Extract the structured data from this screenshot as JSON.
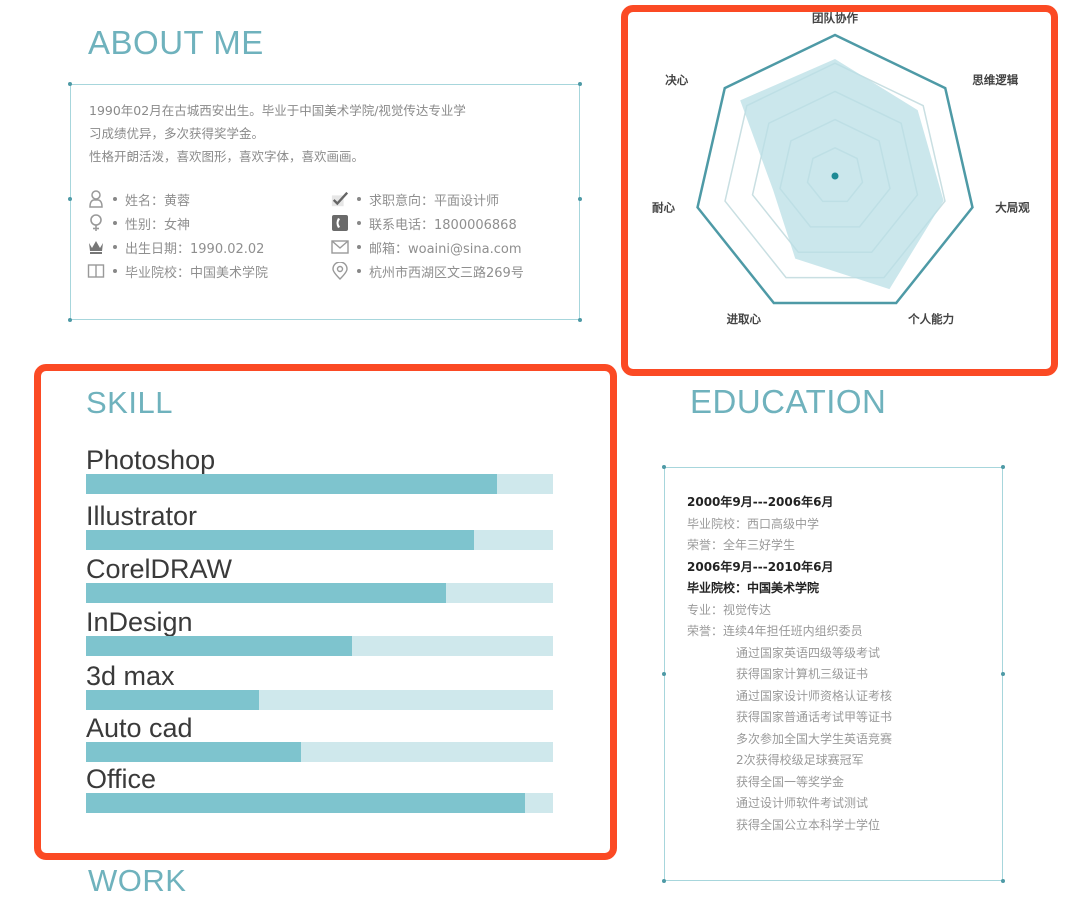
{
  "about": {
    "title": "ABOUT ME",
    "intro": [
      "1990年02月在古城西安出生。毕业于中国美术学院/视觉传达专业学",
      "习成绩优异，多次获得奖学金。",
      "性格开朗活泼，喜欢图形，喜欢字体，喜欢画画。"
    ],
    "left_items": [
      {
        "icon": "person-icon",
        "glyph": "8",
        "text": "姓名：黄蓉"
      },
      {
        "icon": "female-icon",
        "glyph": "♀",
        "text": "性别：女神"
      },
      {
        "icon": "crown-icon",
        "glyph": "♛",
        "text": "出生日期：1990.02.02"
      },
      {
        "icon": "book-icon",
        "glyph": "🕮",
        "text": "毕业院校：中国美术学院"
      }
    ],
    "right_items": [
      {
        "icon": "checkmark-icon",
        "glyph": "✔",
        "text": "求职意向：平面设计师"
      },
      {
        "icon": "phone-icon",
        "glyph": "☎",
        "text": "联系电话：1800006868"
      },
      {
        "icon": "envelope-icon",
        "glyph": "✉",
        "text": "邮箱：woaini@sina.com"
      },
      {
        "icon": "location-pin-icon",
        "glyph": "◎",
        "text": "杭州市西湖区文三路269号"
      }
    ]
  },
  "colors": {
    "accent": "#6fb2bd",
    "bar_fill": "#7ec4ce",
    "bar_track": "#cfe8ec",
    "radar_line": "#4e9aa6",
    "radar_fill": "#b9dfe5",
    "highlight": "#fb4a24"
  },
  "chart_data": [
    {
      "type": "radar",
      "title": "",
      "categories": [
        "团队协作",
        "思维逻辑",
        "大局观",
        "个人能力",
        "进取心",
        "耐心",
        "决心"
      ],
      "values": [
        4.15,
        3.75,
        3.95,
        4.45,
        3.25,
        2.25,
        4.3
      ],
      "range": [
        0,
        5
      ],
      "rings": 5
    },
    {
      "type": "bar",
      "orientation": "horizontal",
      "title": "SKILL",
      "categories": [
        "Photoshop",
        "Illustrator",
        "CorelDRAW",
        "InDesign",
        "3d max",
        "Auto cad",
        "Office"
      ],
      "values": [
        88,
        83,
        77,
        57,
        37,
        46,
        94
      ],
      "range": [
        0,
        100
      ],
      "unit": "percent"
    }
  ],
  "skill": {
    "title": "SKILL"
  },
  "education": {
    "title": "EDUCATION",
    "lines": [
      {
        "text": "2000年9月---2006年6月",
        "style": "strong"
      },
      {
        "text": "毕业院校：西口高级中学",
        "style": "normal"
      },
      {
        "text": "荣誉：全年三好学生",
        "style": "normal"
      },
      {
        "text": "2006年9月---2010年6月",
        "style": "strong"
      },
      {
        "text": "毕业院校：中国美术学院",
        "style": "strong"
      },
      {
        "text": "专业：视觉传达",
        "style": "normal"
      },
      {
        "text": "荣誉：连续4年担任班内组织委员",
        "style": "normal"
      },
      {
        "text": "通过国家英语四级等级考试",
        "style": "indent"
      },
      {
        "text": "获得国家计算机三级证书",
        "style": "indent"
      },
      {
        "text": "通过国家设计师资格认证考核",
        "style": "indent"
      },
      {
        "text": "获得国家普通话考试甲等证书",
        "style": "indent"
      },
      {
        "text": "多次参加全国大学生英语竞赛",
        "style": "indent"
      },
      {
        "text": "2次获得校级足球赛冠军",
        "style": "indent"
      },
      {
        "text": "获得全国一等奖学金",
        "style": "indent"
      },
      {
        "text": "通过设计师软件考试测试",
        "style": "indent"
      },
      {
        "text": "获得全国公立本科学士学位",
        "style": "indent"
      }
    ]
  },
  "work": {
    "title": "WORK"
  }
}
